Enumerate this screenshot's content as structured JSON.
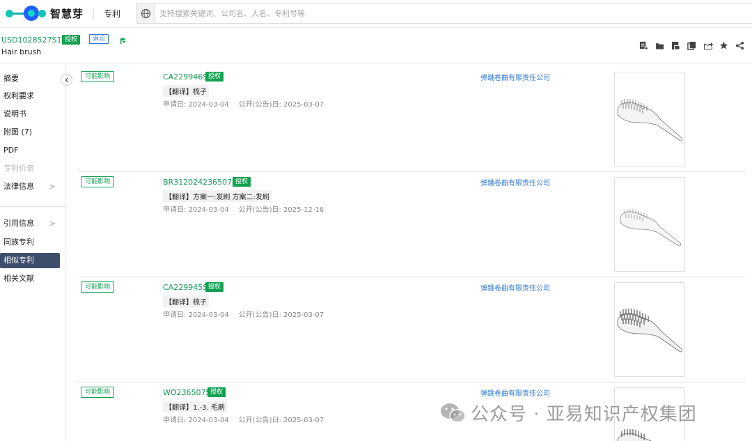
{
  "app": {
    "logo_text": "智慧芽",
    "tab": "专利"
  },
  "search": {
    "placeholder": "支持搜索关键词、公司名、人名、专利号等"
  },
  "patent": {
    "number": "USD1028527S1",
    "status": "授权",
    "litigation": "诉讼",
    "title": "Hair brush"
  },
  "toolbar": {
    "icons": [
      "add-note-icon",
      "folder-icon",
      "pdf-icon",
      "copy-icon",
      "export-icon",
      "star-icon",
      "share-icon"
    ]
  },
  "sidebar": {
    "items": [
      {
        "label": "摘要",
        "state": "normal"
      },
      {
        "label": "权利要求",
        "state": "normal"
      },
      {
        "label": "说明书",
        "state": "normal"
      },
      {
        "label": "附图 (7)",
        "state": "normal"
      },
      {
        "label": "PDF",
        "state": "normal"
      },
      {
        "label": "专利价值",
        "state": "disabled"
      },
      {
        "label": "法律信息",
        "state": "normal",
        "arrow": ">"
      },
      {
        "label": "引用信息",
        "state": "normal",
        "arrow": ">"
      },
      {
        "label": "同族专利",
        "state": "normal"
      },
      {
        "label": "相似专利",
        "state": "active"
      },
      {
        "label": "相关文献",
        "state": "normal"
      }
    ]
  },
  "results": [
    {
      "impact": "可能影响",
      "number": "CA229946S",
      "status": "授权",
      "translation": "【翻译】梳子",
      "apply_date": "申请日: 2024-03-04",
      "pub_date": "公开(公告)日: 2025-03-07",
      "company": "弹跳卷曲有限责任公司"
    },
    {
      "impact": "可能影响",
      "number": "BR312024236507S1",
      "status": "授权",
      "translation": "【翻译】方案一:发刷 方案二:发刷",
      "apply_date": "申请日: 2024-03-04",
      "pub_date": "公开(公告)日: 2025-12-16",
      "company": "弹跳卷曲有限责任公司"
    },
    {
      "impact": "可能影响",
      "number": "CA229945S",
      "status": "授权",
      "translation": "【翻译】梳子",
      "apply_date": "申请日: 2024-03-04",
      "pub_date": "公开(公告)日: 2025-03-07",
      "company": "弹跳卷曲有限责任公司"
    },
    {
      "impact": "可能影响",
      "number": "WO236507S",
      "status": "授权",
      "translation": "【翻译】1.-3. 毛刷",
      "apply_date": "申请日: 2024-03-04",
      "pub_date": "公开(公告)日: 2025-03-07",
      "company": "弹跳卷曲有限责任公司"
    }
  ],
  "watermark": {
    "text": "公众号 · 亚易知识产权集团"
  },
  "colors": {
    "brand_green": "#12a150",
    "link_blue": "#2b78d6",
    "active_nav": "#3d4e6b"
  }
}
